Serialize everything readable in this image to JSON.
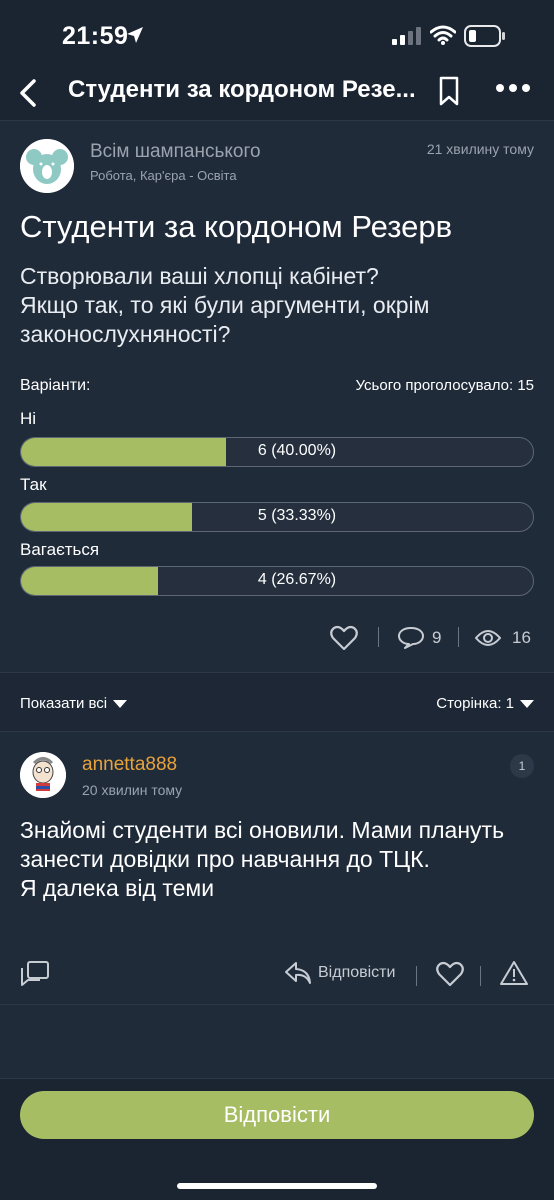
{
  "status": {
    "time": "21:59"
  },
  "nav": {
    "title": "Студенти за кордоном Резе..."
  },
  "post": {
    "author": "Всім шампанського",
    "category": "Робота, Кар'єра - Освіта",
    "time": "21 хвилину тому",
    "title": "Студенти за кордоном Резерв",
    "question_lines": [
      "Створювали ваші хлопці кабінет?",
      "Якщо так, то які були аргументи, окрім законослухняності?"
    ],
    "poll": {
      "label": "Варіанти:",
      "total": "Усього проголосувало: 15",
      "options": [
        {
          "label": "Ні",
          "result": "6 (40.00%)",
          "fraction": 0.4
        },
        {
          "label": "Так",
          "result": "5 (33.33%)",
          "fraction": 0.3333
        },
        {
          "label": "Вагається",
          "result": "4 (26.67%)",
          "fraction": 0.2667
        }
      ]
    },
    "comments_count": "9",
    "views_count": "16"
  },
  "filter": {
    "show_all": "Показати всі",
    "page": "Сторінка: 1"
  },
  "comment": {
    "author": "annetta888",
    "time": "20 хвилин тому",
    "number": "1",
    "text_lines": [
      "Знайомі студенти всі оновили. Мами плануть занести довідки про навчання до ТЦК.",
      "Я далека від теми"
    ],
    "reply_label": "Відповісти"
  },
  "bottom": {
    "reply_button": "Відповісти"
  },
  "colors": {
    "accent": "#a7bd63",
    "author_orange": "#e8a23c",
    "background": "#202b3a"
  }
}
